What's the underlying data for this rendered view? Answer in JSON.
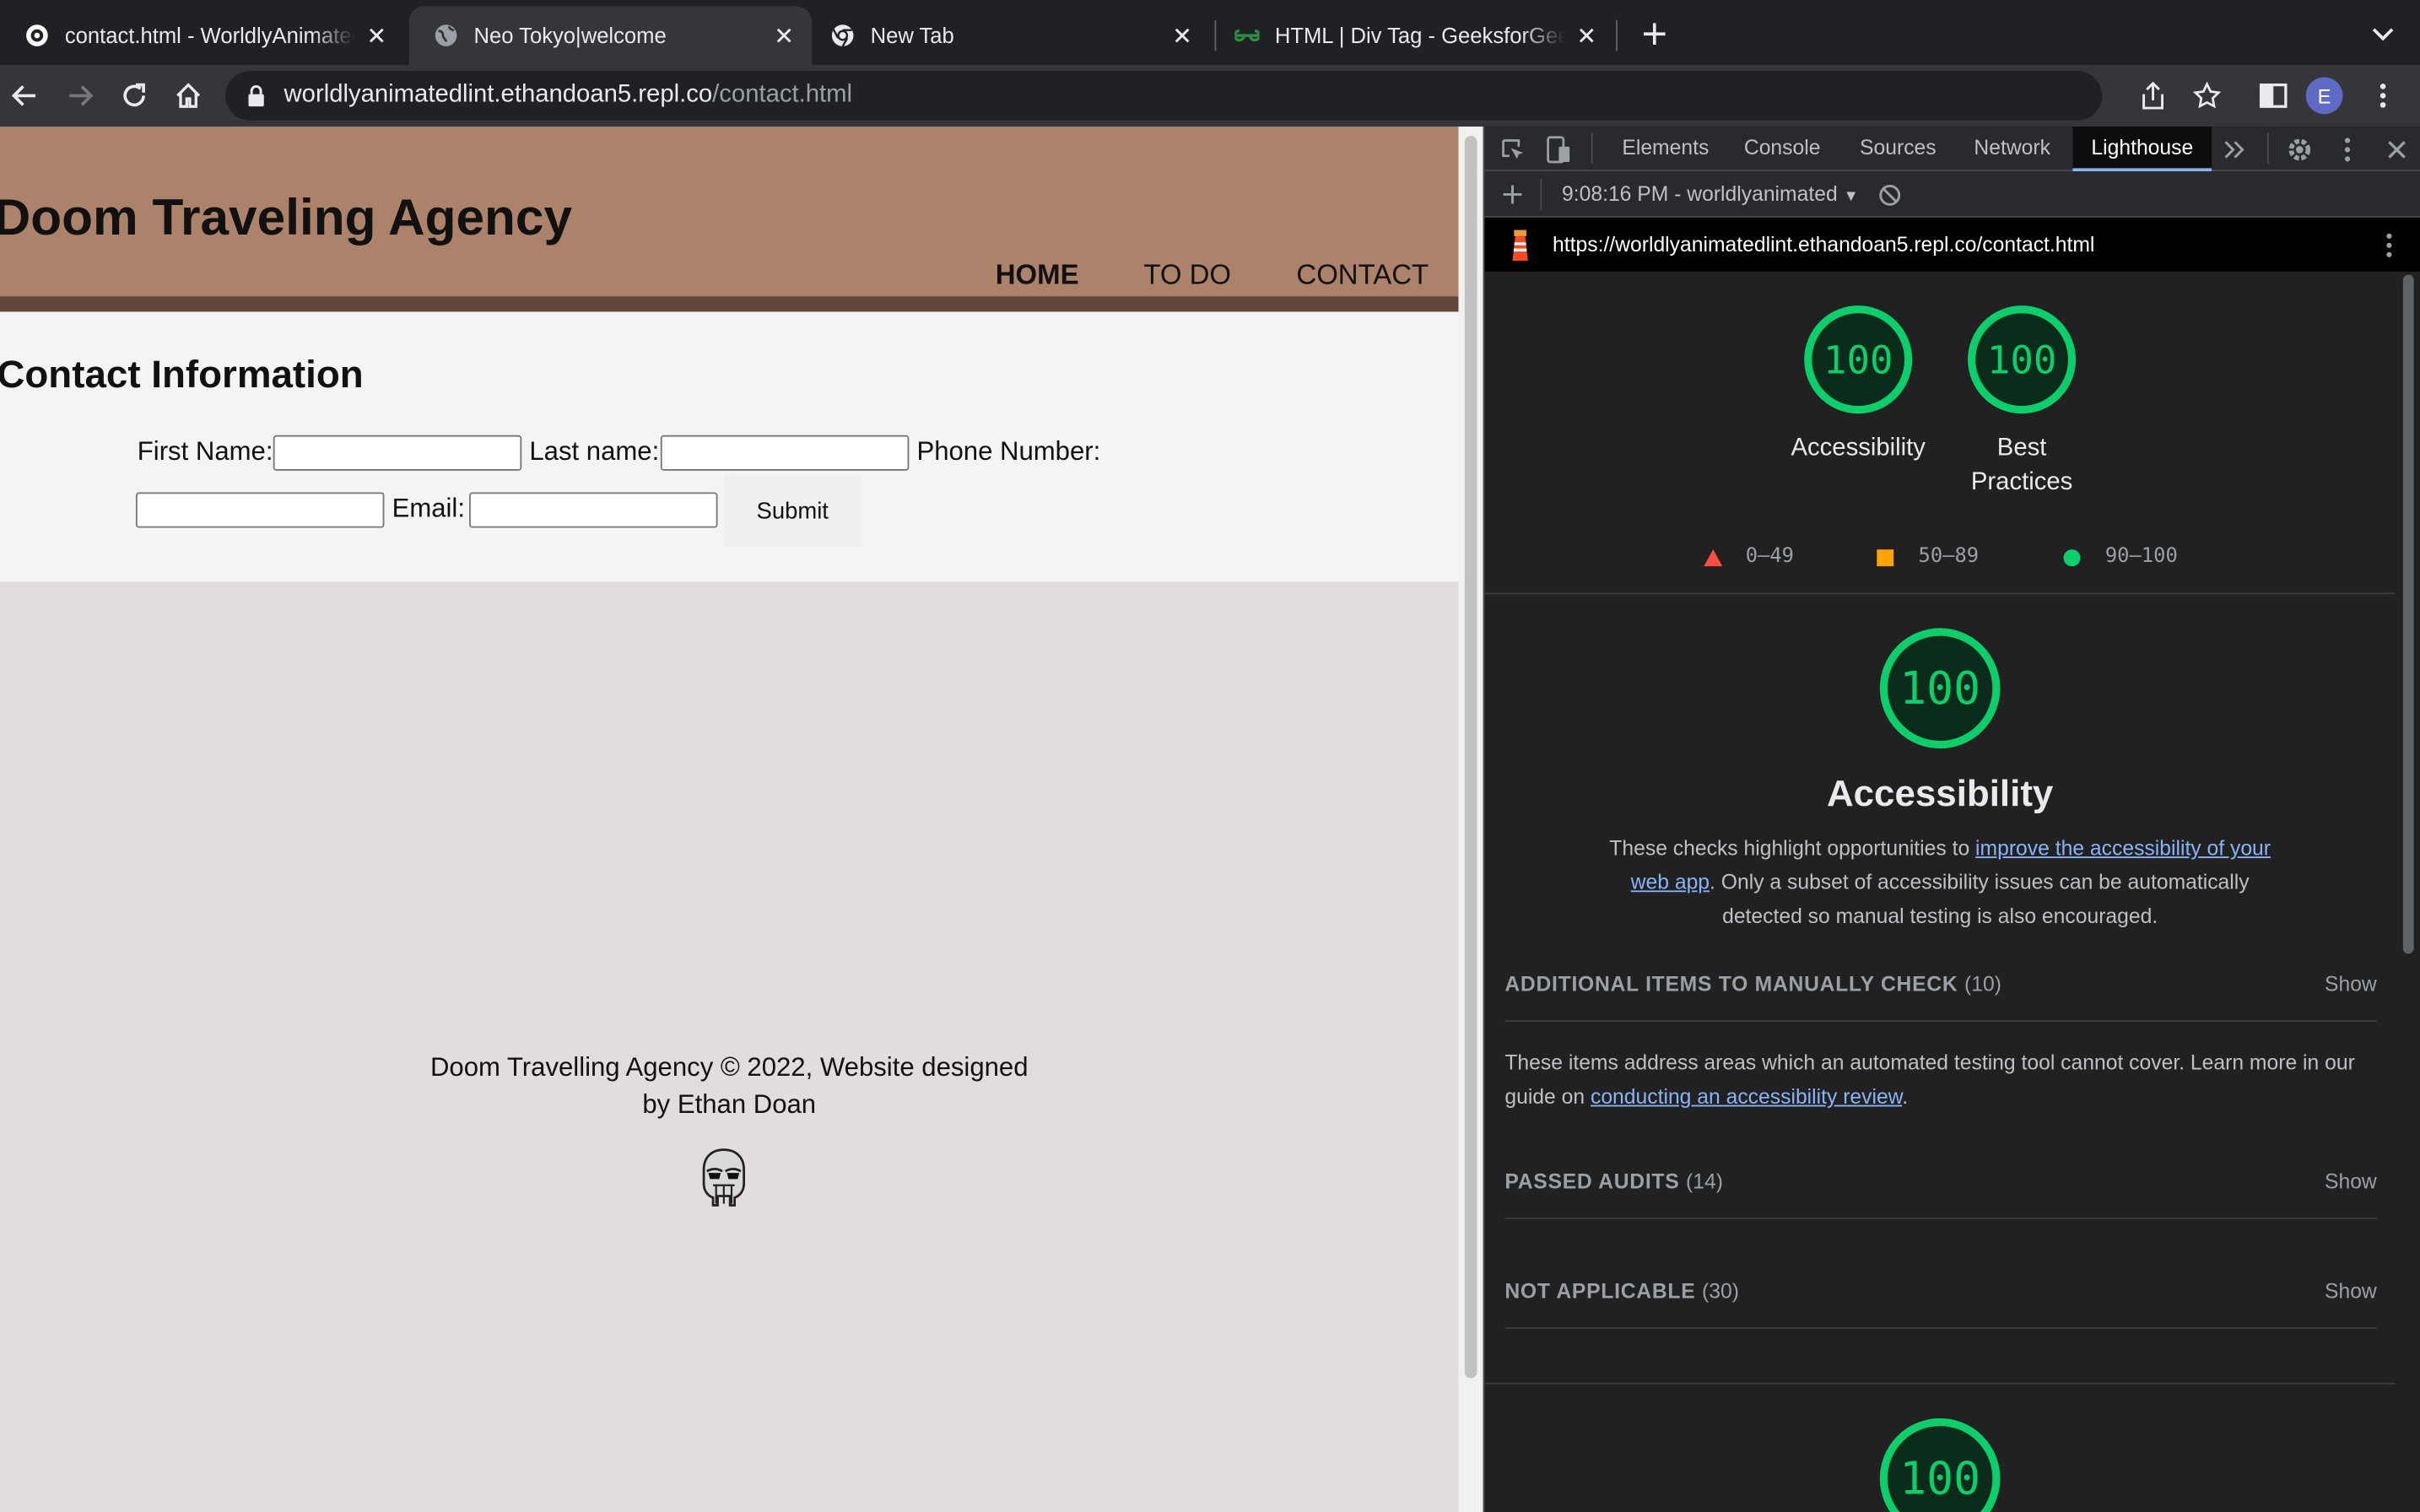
{
  "browser": {
    "tabs": [
      {
        "title": "contact.html - WorldlyAnimatedLint",
        "icon": "replit-icon",
        "active": false
      },
      {
        "title": "Neo Tokyo|welcome",
        "icon": "globe-icon",
        "active": true
      },
      {
        "title": "New Tab",
        "icon": "chrome-icon",
        "active": false
      },
      {
        "title": "HTML | Div Tag - GeeksforGeeks",
        "icon": "geeksforgeeks-icon",
        "active": false
      }
    ],
    "url_host": "worldlyanimatedlint.ethandoan5.repl.co",
    "url_path": "/contact.html",
    "profile_initial": "E"
  },
  "page": {
    "site_title": "Doom Traveling Agency",
    "nav": [
      "HOME",
      "TO DO",
      "CONTACT"
    ],
    "contact_heading": "Contact Information",
    "form": {
      "first_name": "First Name:",
      "last_name": "Last name:",
      "phone": "Phone Number:",
      "email": "Email:",
      "submit": "Submit"
    },
    "footer_line1": "Doom Travelling Agency © 2022, Website designed",
    "footer_line2": "by Ethan Doan"
  },
  "devtools": {
    "tabs": [
      "Elements",
      "Console",
      "Sources",
      "Network",
      "Lighthouse"
    ],
    "active_tab": "Lighthouse",
    "report_selector": "9:08:16 PM - worldlyanimated",
    "report_url": "https://worldlyanimatedlint.ethandoan5.repl.co/contact.html",
    "scores": [
      {
        "label": "Accessibility",
        "score": "100"
      },
      {
        "label_line1": "Best",
        "label_line2": "Practices",
        "score": "100"
      }
    ],
    "legend": [
      "0–49",
      "50–89",
      "90–100"
    ],
    "category": {
      "score": "100",
      "title": "Accessibility",
      "desc_before": "These checks highlight opportunities to ",
      "desc_link": "improve the accessibility of your web app",
      "desc_after": ". Only a subset of accessibility issues can be automatically detected so manual testing is also encouraged."
    },
    "sections": [
      {
        "title": "ADDITIONAL ITEMS TO MANUALLY CHECK",
        "count": "(10)",
        "action": "Show"
      },
      {
        "title": "PASSED AUDITS",
        "count": "(14)",
        "action": "Show"
      },
      {
        "title": "NOT APPLICABLE",
        "count": "(30)",
        "action": "Show"
      }
    ],
    "manual_desc_before": "These items address areas which an automated testing tool cannot cover. Learn more in our guide on ",
    "manual_desc_link": "conducting an accessibility review",
    "manual_desc_after": ".",
    "next_score": "100",
    "colors": {
      "pass": "#0cce6b",
      "average": "#ffa400",
      "fail": "#ff4e42"
    }
  }
}
